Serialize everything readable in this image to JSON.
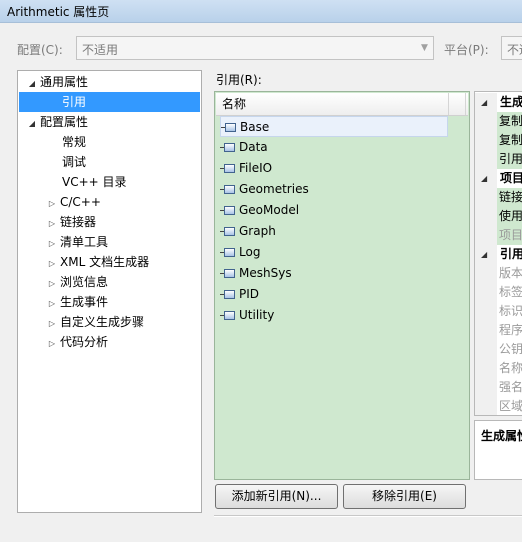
{
  "window": {
    "title": "Arithmetic 属性页"
  },
  "config": {
    "label": "配置(C):",
    "value": "不适用",
    "platform_label": "平台(P):",
    "platform_value": "不适"
  },
  "tree": {
    "items": [
      {
        "label": "通用属性",
        "expander": "open"
      },
      {
        "label": "引用",
        "selected": true
      },
      {
        "label": "配置属性",
        "expander": "open"
      },
      {
        "label": "常规"
      },
      {
        "label": "调试"
      },
      {
        "label": "VC++ 目录"
      },
      {
        "label": "C/C++",
        "expander": "closed"
      },
      {
        "label": "链接器",
        "expander": "closed"
      },
      {
        "label": "清单工具",
        "expander": "closed"
      },
      {
        "label": "XML 文档生成器",
        "expander": "closed"
      },
      {
        "label": "浏览信息",
        "expander": "closed"
      },
      {
        "label": "生成事件",
        "expander": "closed"
      },
      {
        "label": "自定义生成步骤",
        "expander": "closed"
      },
      {
        "label": "代码分析",
        "expander": "closed"
      }
    ]
  },
  "references": {
    "label": "引用(R):",
    "column_name": "名称",
    "items": [
      "Base",
      "Data",
      "FileIO",
      "Geometries",
      "GeoModel",
      "Graph",
      "Log",
      "MeshSys",
      "PID",
      "Utility"
    ]
  },
  "buttons": {
    "add": "添加新引用(N)...",
    "remove": "移除引用(E)"
  },
  "properties": {
    "rows": [
      {
        "type": "cat",
        "label": "生成"
      },
      {
        "type": "rw",
        "label": "复制",
        "green": true
      },
      {
        "type": "rw",
        "label": "复制",
        "green": true
      },
      {
        "type": "rw",
        "label": "引用",
        "green": true
      },
      {
        "type": "cat",
        "label": "项目"
      },
      {
        "type": "rw",
        "label": "链接",
        "green": true
      },
      {
        "type": "rw",
        "label": "使用",
        "green": true
      },
      {
        "type": "ro",
        "label": "项目",
        "green": true
      },
      {
        "type": "cat",
        "label": "引用"
      },
      {
        "type": "ro",
        "label": "版本"
      },
      {
        "type": "ro",
        "label": "标签"
      },
      {
        "type": "ro",
        "label": "标识"
      },
      {
        "type": "ro",
        "label": "程序"
      },
      {
        "type": "ro",
        "label": "公钥"
      },
      {
        "type": "ro",
        "label": "名称"
      },
      {
        "type": "ro",
        "label": "强名"
      },
      {
        "type": "ro",
        "label": "区域"
      }
    ],
    "description_title": "生成属性"
  }
}
